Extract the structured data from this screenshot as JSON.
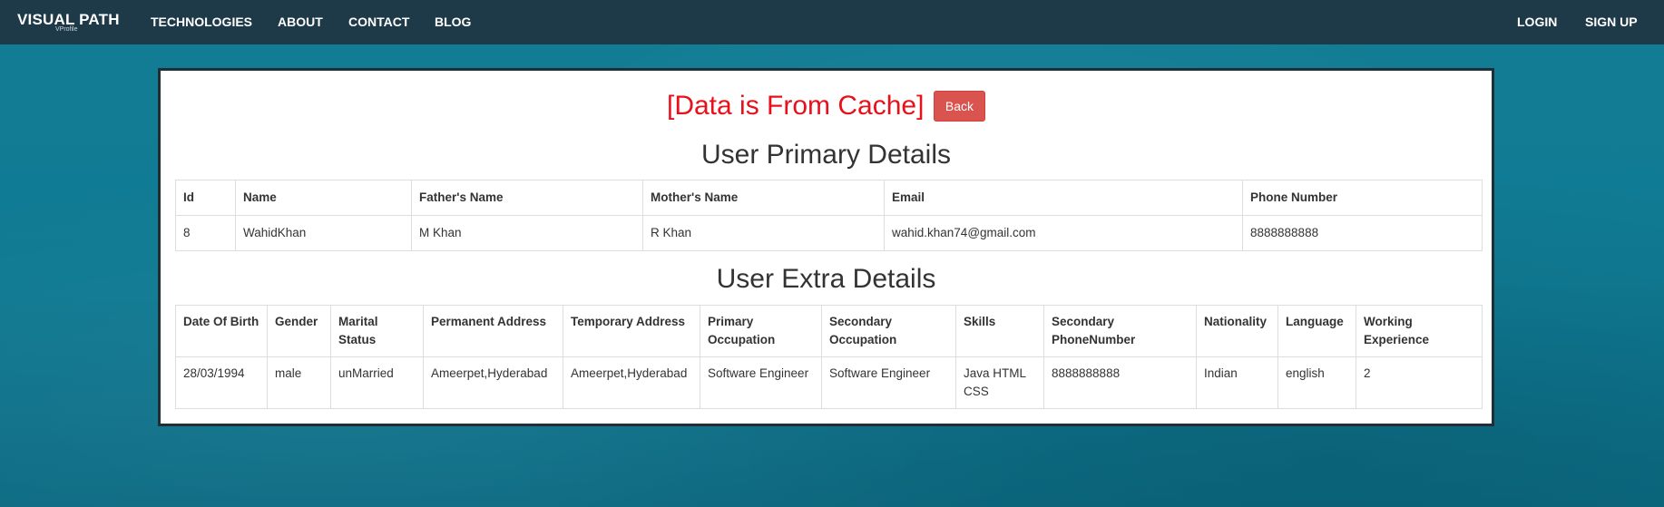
{
  "navbar": {
    "brand": "VISUAL PATH",
    "brand_sub": "VProfile",
    "links": [
      "TECHNOLOGIES",
      "ABOUT",
      "CONTACT",
      "BLOG"
    ],
    "right_links": [
      "LOGIN",
      "SIGN UP"
    ]
  },
  "cache_notice": "[Data is From Cache]",
  "back_label": "Back",
  "primary": {
    "title": "User Primary Details",
    "headers": [
      "Id",
      "Name",
      "Father's Name",
      "Mother's Name",
      "Email",
      "Phone Number"
    ],
    "row": [
      "8",
      "WahidKhan",
      "M Khan",
      "R Khan",
      "wahid.khan74@gmail.com",
      "8888888888"
    ]
  },
  "extra": {
    "title": "User Extra Details",
    "headers": [
      "Date Of Birth",
      "Gender",
      "Marital Status",
      "Permanent Address",
      "Temporary Address",
      "Primary Occupation",
      "Secondary Occupation",
      "Skills",
      "Secondary PhoneNumber",
      "Nationality",
      "Language",
      "Working Experience"
    ],
    "row": [
      "28/03/1994",
      "male",
      "unMarried",
      "Ameerpet,Hyderabad",
      "Ameerpet,Hyderabad",
      "Software Engineer",
      "Software Engineer",
      "Java HTML CSS",
      "8888888888",
      "Indian",
      "english",
      "2"
    ]
  }
}
